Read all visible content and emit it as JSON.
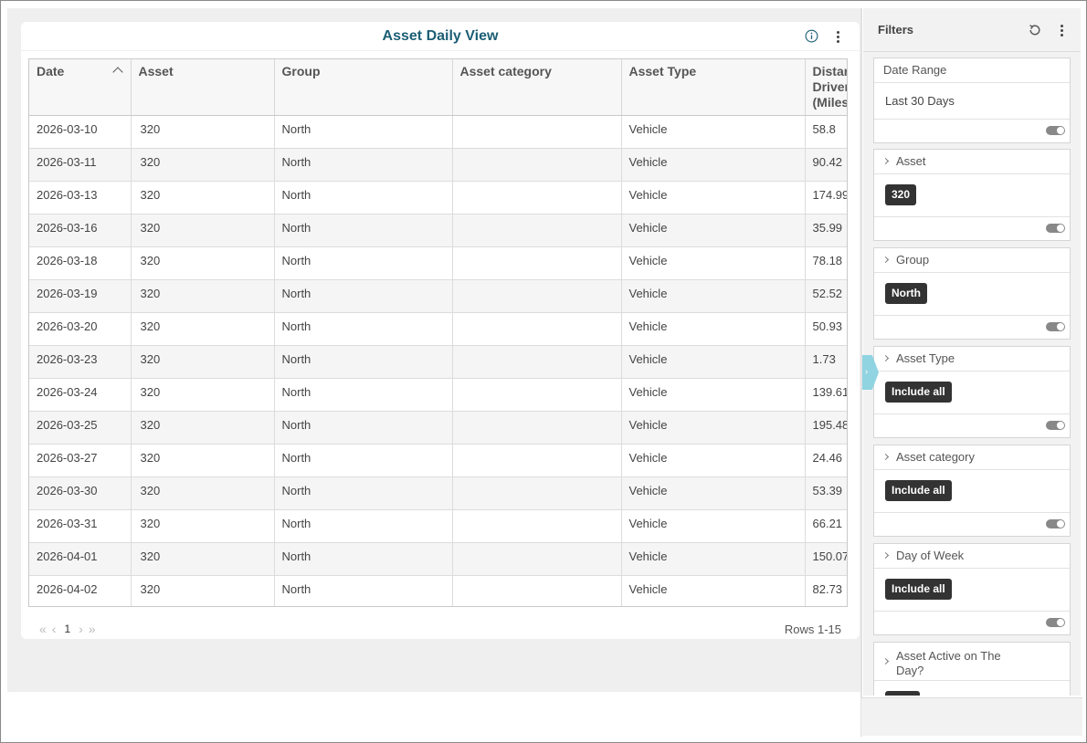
{
  "report": {
    "title": "Asset Daily View",
    "columns": [
      "Date",
      "Asset",
      "Group",
      "Asset category",
      "Asset Type",
      "Distan\nDriven\n(Miles"
    ],
    "rows": [
      [
        "2026-03-10",
        "320",
        "North",
        "",
        "Vehicle",
        "58.8"
      ],
      [
        "2026-03-11",
        "320",
        "North",
        "",
        "Vehicle",
        "90.42"
      ],
      [
        "2026-03-13",
        "320",
        "North",
        "",
        "Vehicle",
        "174.99"
      ],
      [
        "2026-03-16",
        "320",
        "North",
        "",
        "Vehicle",
        "35.99"
      ],
      [
        "2026-03-18",
        "320",
        "North",
        "",
        "Vehicle",
        "78.18"
      ],
      [
        "2026-03-19",
        "320",
        "North",
        "",
        "Vehicle",
        "52.52"
      ],
      [
        "2026-03-20",
        "320",
        "North",
        "",
        "Vehicle",
        "50.93"
      ],
      [
        "2026-03-23",
        "320",
        "North",
        "",
        "Vehicle",
        "1.73"
      ],
      [
        "2026-03-24",
        "320",
        "North",
        "",
        "Vehicle",
        "139.61"
      ],
      [
        "2026-03-25",
        "320",
        "North",
        "",
        "Vehicle",
        "195.48"
      ],
      [
        "2026-03-27",
        "320",
        "North",
        "",
        "Vehicle",
        "24.46"
      ],
      [
        "2026-03-30",
        "320",
        "North",
        "",
        "Vehicle",
        "53.39"
      ],
      [
        "2026-03-31",
        "320",
        "North",
        "",
        "Vehicle",
        "66.21"
      ],
      [
        "2026-04-01",
        "320",
        "North",
        "",
        "Vehicle",
        "150.07"
      ],
      [
        "2026-04-02",
        "320",
        "North",
        "",
        "Vehicle",
        "82.73"
      ]
    ],
    "pager": {
      "page": "1",
      "rows_info": "Rows 1-15"
    },
    "sort_icon": "sort-ascending-icon",
    "info_icon": "info-icon"
  },
  "filters": {
    "title": "Filters",
    "date_range": {
      "label": "Date Range",
      "value": "Last 30 Days"
    },
    "asset": {
      "label": "Asset",
      "chip": "320"
    },
    "group": {
      "label": "Group",
      "chip": "North"
    },
    "asset_type": {
      "label": "Asset Type",
      "chip": "Include all"
    },
    "asset_category": {
      "label": "Asset category",
      "chip": "Include all"
    },
    "day_of_week": {
      "label": "Day of Week",
      "chip": "Include all"
    },
    "asset_active": {
      "label": "Asset Active on The Day?"
    }
  },
  "colors": {
    "title": "#1c5e75",
    "chip_bg": "#333333",
    "collapse_tab": "#8fd4e0"
  }
}
